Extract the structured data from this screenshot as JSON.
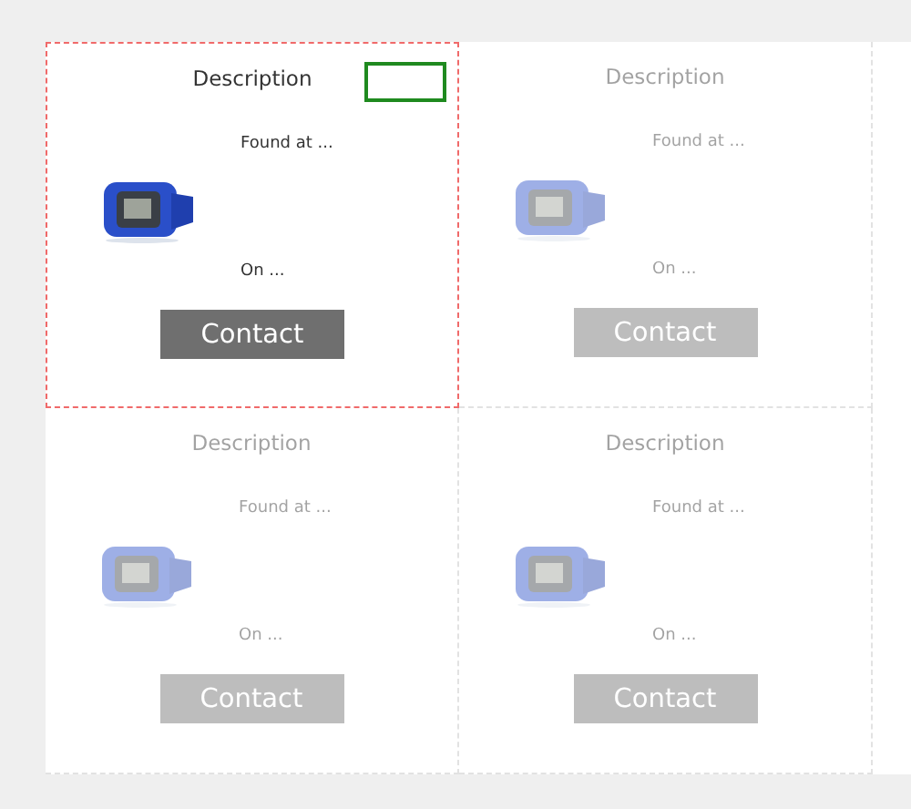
{
  "cards": [
    {
      "description": "Description",
      "found_at": "Found at ...",
      "on": "On ...",
      "button": "Contact",
      "selected": true,
      "marker_box": true
    },
    {
      "description": "Description",
      "found_at": "Found at ...",
      "on": "On ...",
      "button": "Contact",
      "selected": false,
      "marker_box": false
    },
    {
      "description": "Description",
      "found_at": "Found at ...",
      "on": "On ...",
      "button": "Contact",
      "selected": false,
      "marker_box": false
    },
    {
      "description": "Description",
      "found_at": "Found at ...",
      "on": "On ...",
      "button": "Contact",
      "selected": false,
      "marker_box": false
    }
  ]
}
